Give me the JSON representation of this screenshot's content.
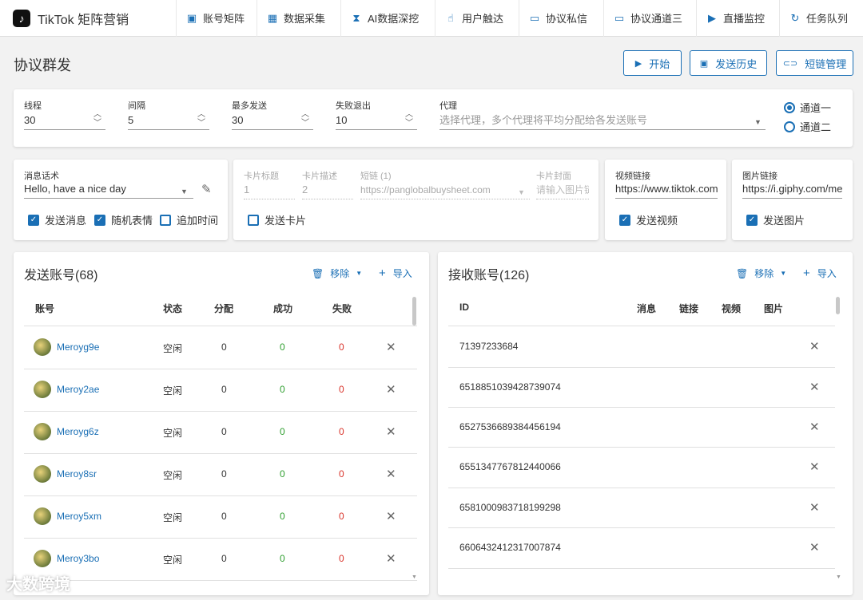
{
  "app": {
    "logo_glyph": "♪",
    "title": "TikTok 矩阵营销"
  },
  "nav": [
    {
      "icon": "id-card-icon",
      "glyph": "▣",
      "label": "账号矩阵"
    },
    {
      "icon": "grid-icon",
      "glyph": "▦",
      "label": "数据采集"
    },
    {
      "icon": "hourglass-icon",
      "glyph": "⧗",
      "label": "AI数据深挖"
    },
    {
      "icon": "user-pointer-icon",
      "glyph": "☝",
      "label": "用户触达"
    },
    {
      "icon": "chat-icon",
      "glyph": "▭",
      "label": "协议私信"
    },
    {
      "icon": "chat-icon",
      "glyph": "▭",
      "label": "协议通道三"
    },
    {
      "icon": "tv-icon",
      "glyph": "▶",
      "label": "直播监控"
    },
    {
      "icon": "refresh-icon",
      "glyph": "↻",
      "label": "任务队列"
    }
  ],
  "page": {
    "title": "协议群发"
  },
  "actions": {
    "start": "开始",
    "history": "发送历史",
    "shortlink": "短链管理"
  },
  "settings": {
    "threads": {
      "label": "线程",
      "value": "30"
    },
    "interval": {
      "label": "间隔",
      "value": "5"
    },
    "max_send": {
      "label": "最多发送",
      "value": "30"
    },
    "fail_exit": {
      "label": "失败退出",
      "value": "10"
    },
    "proxy": {
      "label": "代理",
      "placeholder": "选择代理，多个代理将平均分配给各发送账号"
    },
    "channel1": "通道一",
    "channel2": "通道二"
  },
  "message": {
    "label": "消息话术",
    "value": "Hello, have a nice day",
    "send_message": "发送消息",
    "random_emoji": "随机表情",
    "append_time": "追加时间"
  },
  "card": {
    "title_label": "卡片标题",
    "title_value": "1",
    "desc_label": "卡片描述",
    "desc_value": "2",
    "shortlink_label": "短链 (1)",
    "shortlink_value": "https://panglobalbuysheet.com",
    "cover_label": "卡片封面",
    "cover_placeholder": "请输入图片链接",
    "send_card": "发送卡片"
  },
  "video": {
    "label": "视频链接",
    "value": "https://www.tiktok.com",
    "send": "发送视频"
  },
  "image": {
    "label": "图片链接",
    "value": "https://i.giphy.com/media",
    "send": "发送图片"
  },
  "senders": {
    "title": "发送账号(68)",
    "remove": "移除",
    "import": "导入",
    "columns": [
      "账号",
      "状态",
      "分配",
      "成功",
      "失败"
    ],
    "rows": [
      {
        "name": "Meroyg9e",
        "status": "空闲",
        "assigned": "0",
        "success": "0",
        "fail": "0"
      },
      {
        "name": "Meroy2ae",
        "status": "空闲",
        "assigned": "0",
        "success": "0",
        "fail": "0"
      },
      {
        "name": "Meroyg6z",
        "status": "空闲",
        "assigned": "0",
        "success": "0",
        "fail": "0"
      },
      {
        "name": "Meroy8sr",
        "status": "空闲",
        "assigned": "0",
        "success": "0",
        "fail": "0"
      },
      {
        "name": "Meroy5xm",
        "status": "空闲",
        "assigned": "0",
        "success": "0",
        "fail": "0"
      },
      {
        "name": "Meroy3bo",
        "status": "空闲",
        "assigned": "0",
        "success": "0",
        "fail": "0"
      }
    ]
  },
  "receivers": {
    "title": "接收账号(126)",
    "remove": "移除",
    "import": "导入",
    "columns": [
      "ID",
      "消息",
      "链接",
      "视频",
      "图片"
    ],
    "rows": [
      "71397233684",
      "6518851039428739074",
      "6527536689384456194",
      "6551347767812440066",
      "6581000983718199298",
      "6606432412317007874"
    ]
  },
  "watermark": "大数跨境",
  "colors": {
    "accent": "#1a6fb5",
    "success": "#2e9e2e",
    "fail": "#d9342b"
  }
}
